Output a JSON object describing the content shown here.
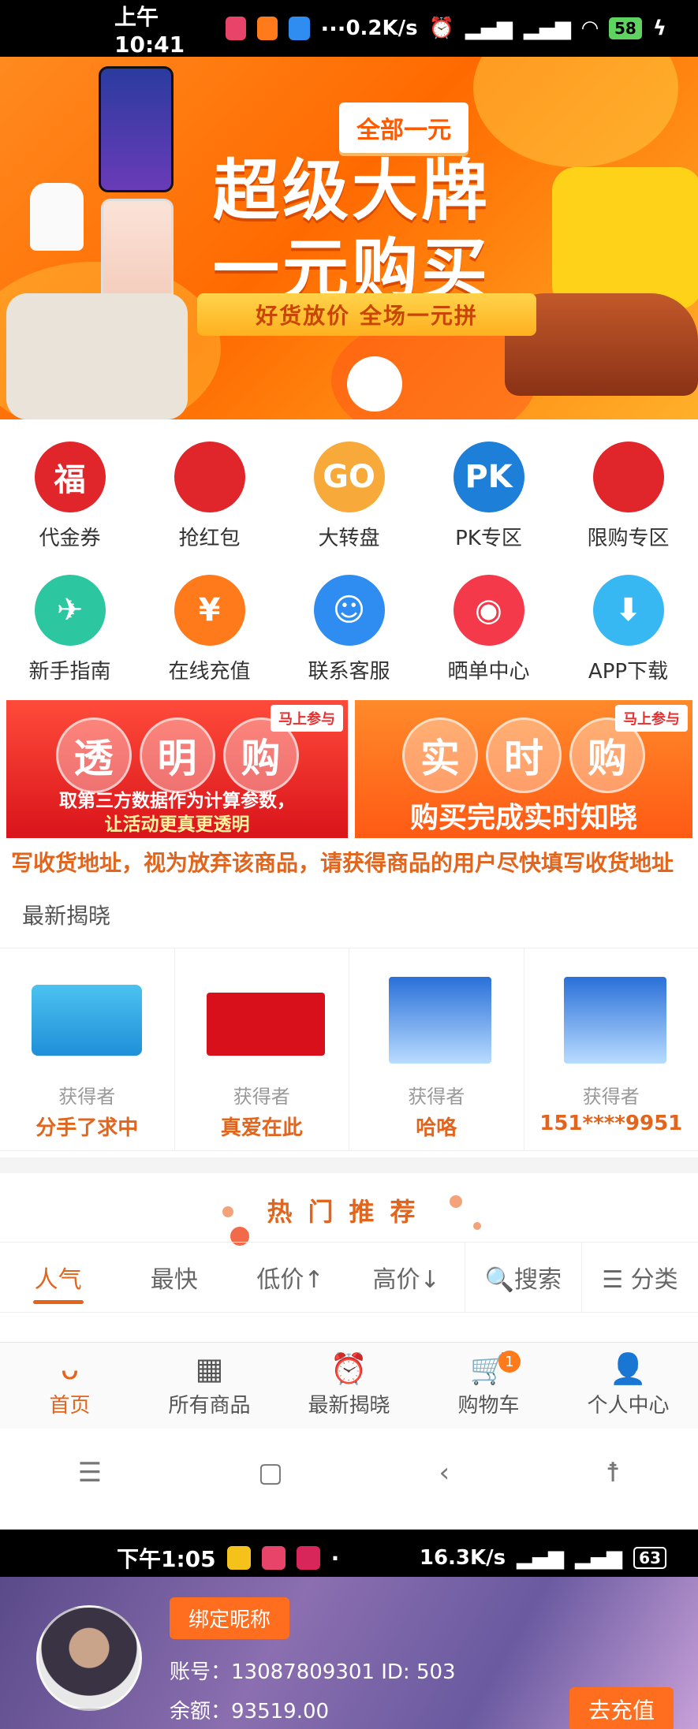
{
  "status_top": {
    "time": "上午10:41",
    "dots": "···",
    "speed": "0.2K/s",
    "battery": "58"
  },
  "banner": {
    "tag": "全部一元",
    "headline1": "超级大牌",
    "headline2": "一元购买",
    "slogan": "好货放价 全场一元拼"
  },
  "icons": [
    {
      "label": "代金券",
      "color": "#e0262a",
      "icon": "lucky-bag-icon",
      "glyph": "福"
    },
    {
      "label": "抢红包",
      "color": "#e0262a",
      "icon": "red-envelope-icon",
      "glyph": ""
    },
    {
      "label": "大转盘",
      "color": "#f7a93a",
      "icon": "wheel-icon",
      "glyph": "GO"
    },
    {
      "label": "PK专区",
      "color": "#1e7fd8",
      "icon": "pk-icon",
      "glyph": "PK"
    },
    {
      "label": "限购专区",
      "color": "#e0262a",
      "icon": "limit-icon",
      "glyph": ""
    },
    {
      "label": "新手指南",
      "color": "#2cc7a0",
      "icon": "compass-icon",
      "glyph": "✈"
    },
    {
      "label": "在线充值",
      "color": "#ff7a1a",
      "icon": "recharge-icon",
      "glyph": "¥"
    },
    {
      "label": "联系客服",
      "color": "#2f8cf0",
      "icon": "headset-icon",
      "glyph": "☺"
    },
    {
      "label": "晒单中心",
      "color": "#f43a4a",
      "icon": "camera-icon",
      "glyph": "◉"
    },
    {
      "label": "APP下载",
      "color": "#38b8f2",
      "icon": "download-icon",
      "glyph": "⬇"
    }
  ],
  "promo_left": {
    "badge": "马上参与",
    "c1": "透",
    "c2": "明",
    "c3": "购",
    "line1": "取第三方数据作为计算参数，",
    "line2": "让活动更真更透明"
  },
  "promo_right": {
    "badge": "马上参与",
    "c1": "实",
    "c2": "时",
    "c3": "购",
    "line": "购买完成实时知晓"
  },
  "ticker": "写收货地址，视为放弃该商品，请获得商品的用户尽快填写收货地址",
  "latest_title": "最新揭晓",
  "winner_caption": "获得者",
  "winners": [
    {
      "name": "分手了求中",
      "product": "jd-card"
    },
    {
      "name": "真爱在此",
      "product": "cigarettes"
    },
    {
      "name": "哈咯",
      "product": "durex"
    },
    {
      "name": "151****9951",
      "product": "durex"
    }
  ],
  "hot_title": "热门推荐",
  "tabs": [
    "人气",
    "最快",
    "低价↑",
    "高价↓",
    "🔍搜索",
    "☰ 分类"
  ],
  "bottom_nav": [
    {
      "label": "首页",
      "icon": "home-icon"
    },
    {
      "label": "所有商品",
      "icon": "grid-icon"
    },
    {
      "label": "最新揭晓",
      "icon": "alarm-icon"
    },
    {
      "label": "购物车",
      "icon": "cart-icon",
      "count": "1"
    },
    {
      "label": "个人中心",
      "icon": "user-icon"
    }
  ],
  "status_bottom": {
    "time": "下午1:05",
    "dot": "·",
    "speed": "16.3K/s",
    "battery": "63"
  },
  "profile": {
    "bind_label": "绑定昵称",
    "account": "账号：13087809301   ID: 503",
    "balance": "余额：93519.00",
    "recharge_label": "去充值"
  }
}
